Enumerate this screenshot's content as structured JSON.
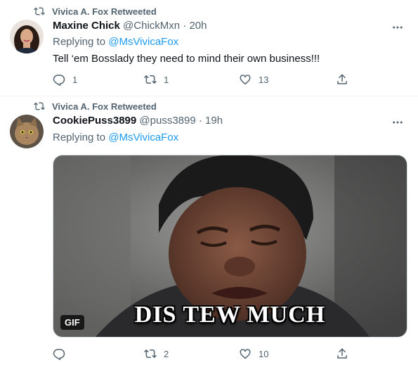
{
  "tweets": [
    {
      "retweet_label": "Vivica A. Fox Retweeted",
      "display_name": "Maxine Chick",
      "handle": "@ChickMxn",
      "separator": "·",
      "time": "20h",
      "replying_prefix": "Replying to",
      "replying_to": "@MsVivicaFox",
      "text": "Tell ‘em Bosslady they need to mind their own business!!!",
      "replies": "1",
      "retweets": "1",
      "likes": "13"
    },
    {
      "retweet_label": "Vivica A. Fox Retweeted",
      "display_name": "CookiePuss3899",
      "handle": "@puss3899",
      "separator": "·",
      "time": "19h",
      "replying_prefix": "Replying to",
      "replying_to": "@MsVivicaFox",
      "media": {
        "badge": "GIF",
        "caption": "DIS TEW MUCH"
      },
      "replies": "",
      "retweets": "2",
      "likes": "10"
    }
  ],
  "colors": {
    "accent": "#1d9bf0",
    "secondary_text": "#536471",
    "primary_text": "#0f1419",
    "divider": "#eff3f4"
  },
  "icons": [
    "retweet-icon",
    "more-icon",
    "reply-icon",
    "like-icon",
    "share-icon",
    "avatar"
  ]
}
